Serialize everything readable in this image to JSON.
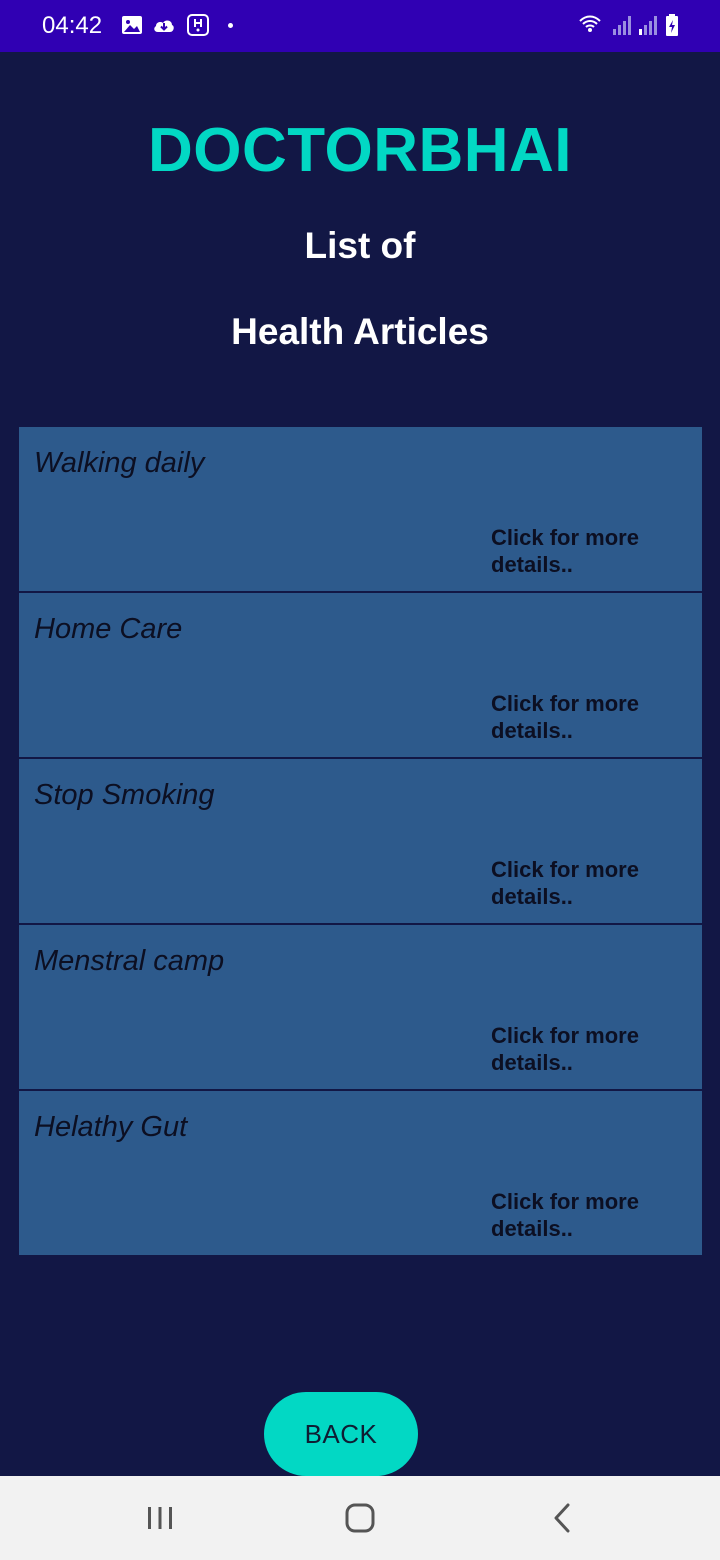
{
  "status_bar": {
    "time": "04:42",
    "icons": [
      "image-icon",
      "cloud-download-icon",
      "app-notification-icon",
      "wifi-icon",
      "signal-icon",
      "signal-icon-2",
      "battery-charging-icon"
    ]
  },
  "header": {
    "app_title": "DOCTORBHAI",
    "subtitle_line1": "List of",
    "subtitle_line2": "Health Articles"
  },
  "articles": [
    {
      "title": "Walking daily",
      "more": "Click for more details.."
    },
    {
      "title": "Home Care",
      "more": "Click for more details.."
    },
    {
      "title": "Stop Smoking",
      "more": "Click for more details.."
    },
    {
      "title": "Menstral camp",
      "more": "Click for more details.."
    },
    {
      "title": "Helathy Gut",
      "more": "Click for more details.."
    }
  ],
  "back_button": {
    "label": "BACK"
  },
  "nav_bar": {
    "icons": [
      "recent-apps-icon",
      "home-icon",
      "back-nav-icon"
    ]
  },
  "colors": {
    "background": "#121745",
    "status_bar": "#3000b3",
    "accent": "#02d8c4",
    "card": "#2d5a8c",
    "nav_bar": "#f2f2f2"
  }
}
